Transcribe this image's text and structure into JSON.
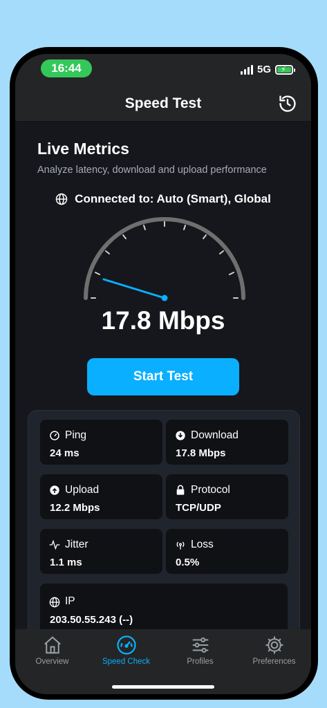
{
  "status": {
    "time": "16:44",
    "network": "5G"
  },
  "header": {
    "title": "Speed Test"
  },
  "metrics": {
    "title": "Live Metrics",
    "subtitle": "Analyze latency, download and upload performance",
    "connected": "Connected to: Auto (Smart), Global",
    "speed": "17.8 Mbps",
    "start_label": "Start Test"
  },
  "stats": {
    "ping": {
      "label": "Ping",
      "value": "24 ms"
    },
    "download": {
      "label": "Download",
      "value": "17.8 Mbps"
    },
    "upload": {
      "label": "Upload",
      "value": "12.2 Mbps"
    },
    "protocol": {
      "label": "Protocol",
      "value": "TCP/UDP"
    },
    "jitter": {
      "label": "Jitter",
      "value": "1.1 ms"
    },
    "loss": {
      "label": "Loss",
      "value": "0.5%"
    },
    "ip": {
      "label": "IP",
      "value": "203.50.55.243 (--)"
    }
  },
  "tabs": [
    {
      "label": "Overview",
      "icon": "home-icon"
    },
    {
      "label": "Speed Check",
      "icon": "speedometer-icon",
      "active": true
    },
    {
      "label": "Profiles",
      "icon": "sliders-icon"
    },
    {
      "label": "Preferences",
      "icon": "gear-icon"
    }
  ],
  "colors": {
    "accent": "#0aafff",
    "time_pill": "#34c759",
    "background": "#15171c"
  }
}
